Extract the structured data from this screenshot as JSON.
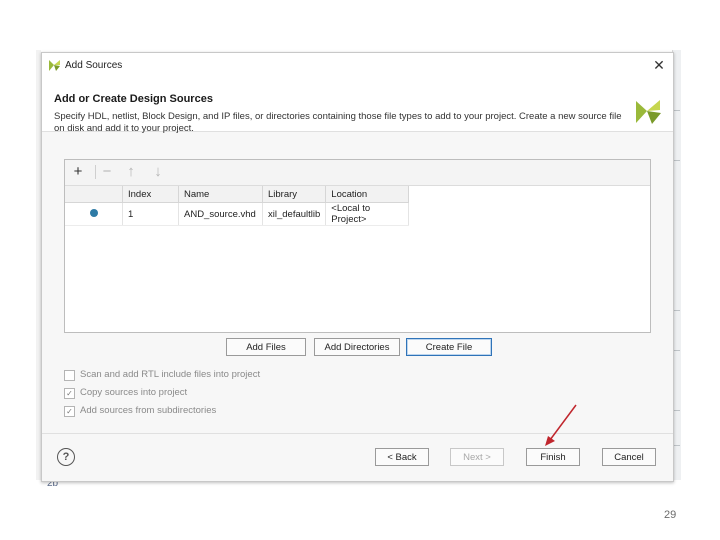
{
  "dialog": {
    "title": "Add Sources",
    "close_glyph": "✕",
    "heading": "Add or Create Design Sources",
    "description": "Specify HDL, netlist, Block Design, and IP files, or directories containing those file types to add to your project. Create a new source file on disk and add it to your project."
  },
  "toolbar": {
    "add_glyph": "+",
    "remove_glyph": "−",
    "up_glyph": "↑",
    "down_glyph": "↓"
  },
  "table": {
    "columns": [
      "Index",
      "Name",
      "Library",
      "Location"
    ],
    "rows": [
      {
        "index": "1",
        "name": "AND_source.vhd",
        "library": "xil_defaultlib",
        "location": "<Local to Project>"
      }
    ]
  },
  "file_buttons": {
    "add_files": "Add Files",
    "add_directories": "Add Directories",
    "create_file": "Create File"
  },
  "options": [
    {
      "label": "Scan and add RTL include files into project",
      "checked": false
    },
    {
      "label": "Copy sources into project",
      "checked": true
    },
    {
      "label": "Add sources from subdirectories",
      "checked": true
    }
  ],
  "footer": {
    "help_glyph": "?",
    "back": "< Back",
    "next": "Next >",
    "finish": "Finish",
    "cancel": "Cancel"
  },
  "slide": {
    "number": "29",
    "stray_text": "2b"
  },
  "colors": {
    "logo": "#9ab93a",
    "annotation_arrow": "#c0262d",
    "focus_border": "#2f73b8"
  }
}
